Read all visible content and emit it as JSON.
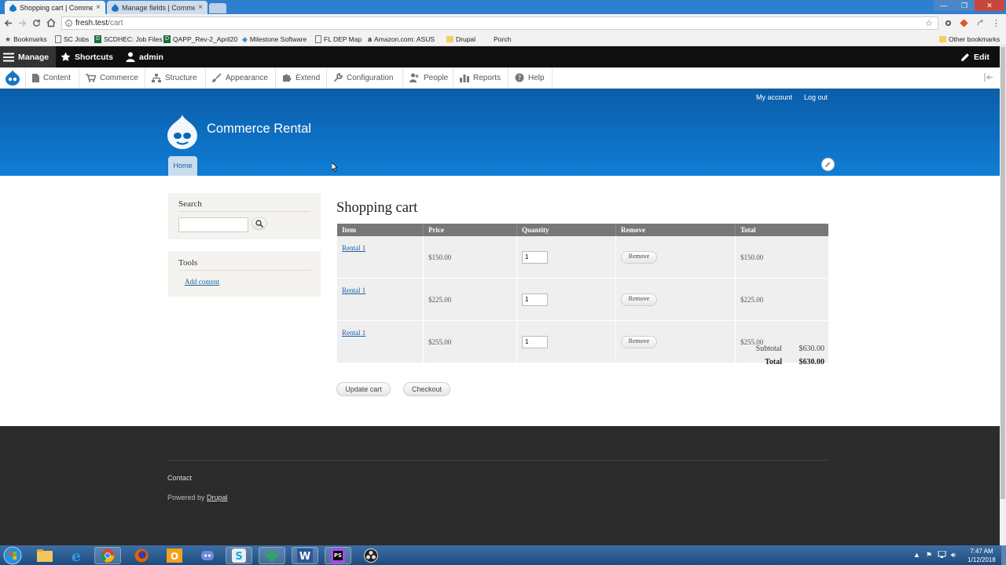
{
  "browser": {
    "tabs": [
      {
        "title": "Shopping cart | Comme",
        "close": "×"
      },
      {
        "title": "Manage fields | Comme",
        "close": "×"
      }
    ],
    "url_host": "fresh.test",
    "url_path": "/cart",
    "window_buttons": [
      "—",
      "❐",
      "✕"
    ],
    "bookmarks": [
      {
        "label": "Bookmarks",
        "icon": "star-icon"
      },
      {
        "label": "SC Jobs",
        "icon": "page-icon"
      },
      {
        "label": "SCDHEC: Job Files",
        "icon": "d-icon"
      },
      {
        "label": "QAPP_Rev-2_April20",
        "icon": "d-icon"
      },
      {
        "label": "Milestone Software",
        "icon": "diamond-icon"
      },
      {
        "label": "FL DEP Map",
        "icon": "page-icon"
      },
      {
        "label": "Amazon.com: ASUS",
        "icon": "amazon-icon"
      },
      {
        "label": "Drupal",
        "icon": "folder-icon"
      },
      {
        "label": "Porch",
        "icon": "blank-icon"
      }
    ],
    "other_bookmarks": "Other bookmarks"
  },
  "admin_toolbar": {
    "manage": "Manage",
    "shortcuts": "Shortcuts",
    "user": "admin",
    "edit": "Edit"
  },
  "admin_menu": [
    "Content",
    "Commerce",
    "Structure",
    "Appearance",
    "Extend",
    "Configuration",
    "People",
    "Reports",
    "Help"
  ],
  "site": {
    "name": "Commerce Rental",
    "secondary_menu": [
      "My account",
      "Log out"
    ],
    "main_menu": [
      "Home"
    ]
  },
  "sidebar": {
    "search_title": "Search",
    "tools_title": "Tools",
    "tools_links": [
      "Add content"
    ]
  },
  "cart": {
    "title": "Shopping cart",
    "columns": [
      "Item",
      "Price",
      "Quantity",
      "Remove",
      "Total"
    ],
    "rows": [
      {
        "item": "Rental 1",
        "price": "$150.00",
        "quantity": "1",
        "remove": "Remove",
        "total": "$150.00"
      },
      {
        "item": "Rental 1",
        "price": "$225.00",
        "quantity": "1",
        "remove": "Remove",
        "total": "$225.00"
      },
      {
        "item": "Rental 1",
        "price": "$255.00",
        "quantity": "1",
        "remove": "Remove",
        "total": "$255.00"
      }
    ],
    "subtotal_label": "Subtotal",
    "subtotal_value": "$630.00",
    "total_label": "Total",
    "total_value": "$630.00",
    "update_button": "Update cart",
    "checkout_button": "Checkout"
  },
  "footer": {
    "contact": "Contact",
    "powered_prefix": "Powered by",
    "powered_link": "Drupal"
  },
  "taskbar": {
    "time": "7:47 AM",
    "date": "1/12/2018",
    "apps": [
      "windows-start",
      "file-explorer",
      "internet-explorer",
      "chrome",
      "firefox",
      "outlook",
      "discord",
      "skype",
      "gitkraken",
      "word",
      "phpstorm",
      "obs"
    ]
  },
  "colors": {
    "header_blue": "#0f7ed6",
    "admin_black": "#0f0f0f",
    "table_header": "#777777",
    "footer_dark": "#2b2b2b",
    "link_blue": "#1c62a4"
  }
}
